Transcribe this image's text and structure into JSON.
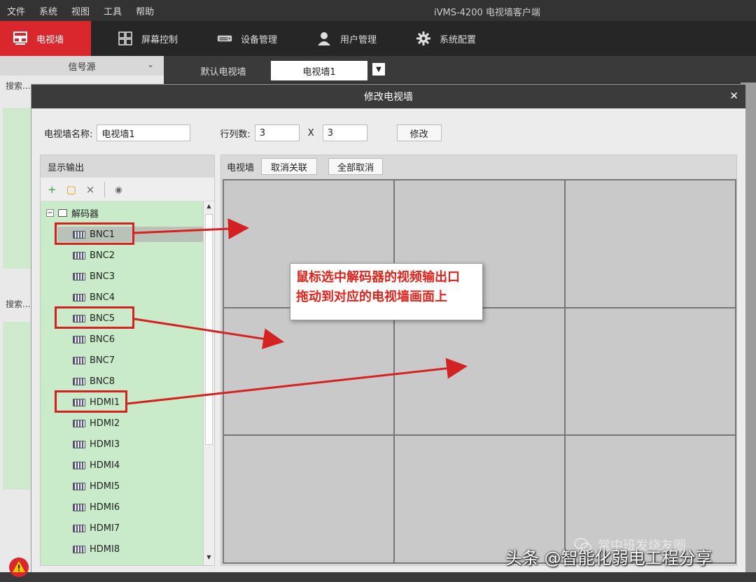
{
  "menu": [
    "文件",
    "系统",
    "视图",
    "工具",
    "帮助"
  ],
  "app_title": "iVMS-4200 电视墙客户端",
  "modules": [
    {
      "label": "电视墙",
      "icon": "tv-wall-icon",
      "active": true
    },
    {
      "label": "屏幕控制",
      "icon": "grid-icon",
      "active": false
    },
    {
      "label": "设备管理",
      "icon": "device-icon",
      "active": false
    },
    {
      "label": "用户管理",
      "icon": "user-icon",
      "active": false
    },
    {
      "label": "系统配置",
      "icon": "gear-icon",
      "active": false
    }
  ],
  "left_panel": {
    "header": "信号源",
    "search_top": "搜索...",
    "search_bottom": "搜索..."
  },
  "wall_tabs": {
    "default": "默认电视墙",
    "current": "电视墙1"
  },
  "dialog": {
    "title": "修改电视墙",
    "name_label": "电视墙名称:",
    "name_value": "电视墙1",
    "rowcol_label": "行列数:",
    "rows": "3",
    "x": "X",
    "cols": "3",
    "modify_button": "修改"
  },
  "tree": {
    "header": "显示输出",
    "root": "解码器",
    "items": [
      "BNC1",
      "BNC2",
      "BNC3",
      "BNC4",
      "BNC5",
      "BNC6",
      "BNC7",
      "BNC8",
      "HDMI1",
      "HDMI2",
      "HDMI3",
      "HDMI4",
      "HDMI5",
      "HDMI6",
      "HDMI7",
      "HDMI8"
    ]
  },
  "wall": {
    "label": "电视墙",
    "unlink_button": "取消关联",
    "cancel_all_button": "全部取消",
    "rows": 3,
    "cols": 3
  },
  "callout": {
    "line1": "鼠标选中解码器的视频输出口",
    "line2": "拖动到对应的电视墙画面上"
  },
  "watermark": "头条 @智能化弱电工程分享",
  "watermark_faint": "常中班发烧友圈",
  "colors": {
    "accent": "#d9272e",
    "annotation": "#d42222",
    "tree_bg": "#c9ebc9"
  }
}
